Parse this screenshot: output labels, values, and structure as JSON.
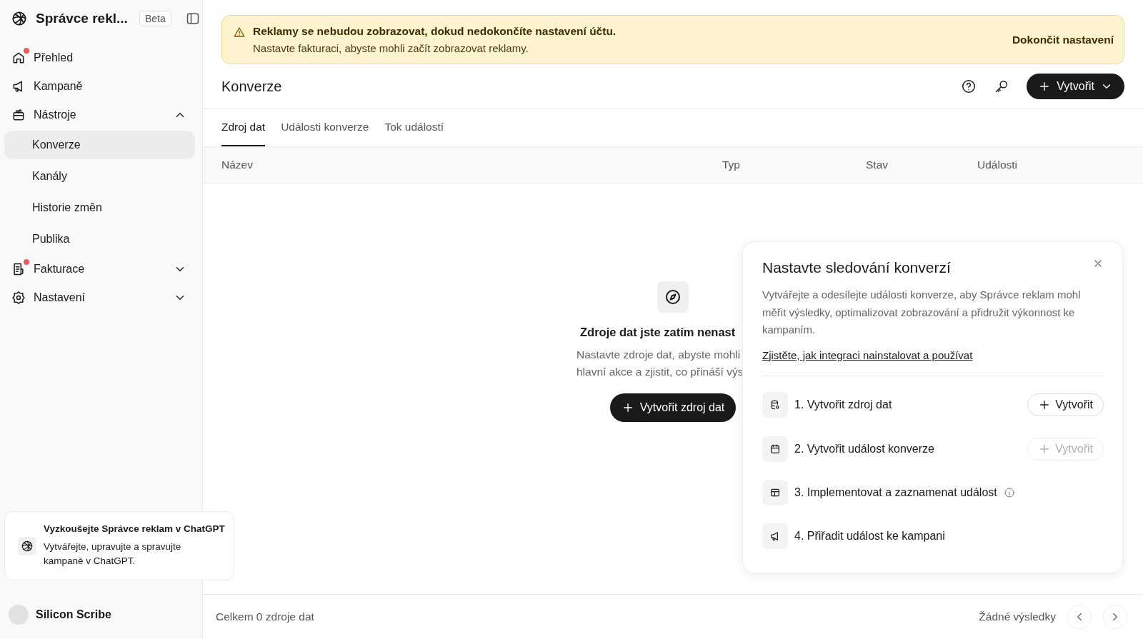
{
  "sidebar": {
    "brand": "Správce rekl...",
    "badge": "Beta",
    "nav": [
      {
        "label": "Přehled",
        "dot": true
      },
      {
        "label": "Kampaně",
        "dot": false
      },
      {
        "label": "Nástroje",
        "dot": false,
        "expanded": true,
        "children": [
          {
            "label": "Konverze",
            "selected": true
          },
          {
            "label": "Kanály",
            "selected": false
          },
          {
            "label": "Historie změn",
            "selected": false
          },
          {
            "label": "Publika",
            "selected": false
          }
        ]
      },
      {
        "label": "Fakturace",
        "dot": true,
        "expanded": false
      },
      {
        "label": "Nastavení",
        "dot": false,
        "expanded": false
      }
    ],
    "promo": {
      "title": "Vyzkoušejte Správce reklam v ChatGPT",
      "text": "Vytvářejte, upravujte a spravujte kampaně v ChatGPT."
    },
    "user": {
      "name": "Silicon Scribe"
    }
  },
  "banner": {
    "title": "Reklamy se nebudou zobrazovat, dokud nedokončíte nastavení účtu.",
    "text": "Nastavte fakturaci, abyste mohli začít zobrazovat reklamy.",
    "action": "Dokončit nastavení"
  },
  "header": {
    "title": "Konverze",
    "create_button": "Vytvořit"
  },
  "tabs": [
    {
      "label": "Zdroj dat",
      "selected": true
    },
    {
      "label": "Události konverze",
      "selected": false
    },
    {
      "label": "Tok událostí",
      "selected": false
    }
  ],
  "table": {
    "columns": [
      "Název",
      "Typ",
      "Stav",
      "Události"
    ]
  },
  "empty_state": {
    "title": "Zdroje dat jste zatím nenast",
    "lines": [
      "Nastavte zdroje dat, abyste mohli",
      "hlavní akce a zjistit, co přináší výs"
    ],
    "button": "Vytvořit zdroj dat"
  },
  "setup_panel": {
    "title": "Nastavte sledování konverzí",
    "description": "Vytvářejte a odesílejte události konverze, aby Správce reklam mohl měřit výsledky, optimalizovat zobrazování a přidružit výkonnost ke kampaním.",
    "link": "Zjistěte, jak integraci nainstalovat a používat",
    "steps": [
      {
        "label": "1. Vytvořit zdroj dat",
        "button": "Vytvořit",
        "disabled": false
      },
      {
        "label": "2. Vytvořit událost konverze",
        "button": "Vytvořit",
        "disabled": true
      },
      {
        "label": "3. Implementovat a zaznamenat událost",
        "info": true
      },
      {
        "label": "4. Přiřadit událost ke kampani",
        "info": false
      }
    ]
  },
  "footer": {
    "total": "Celkem 0 zdroje dat",
    "results": "Žádné výsledky"
  }
}
